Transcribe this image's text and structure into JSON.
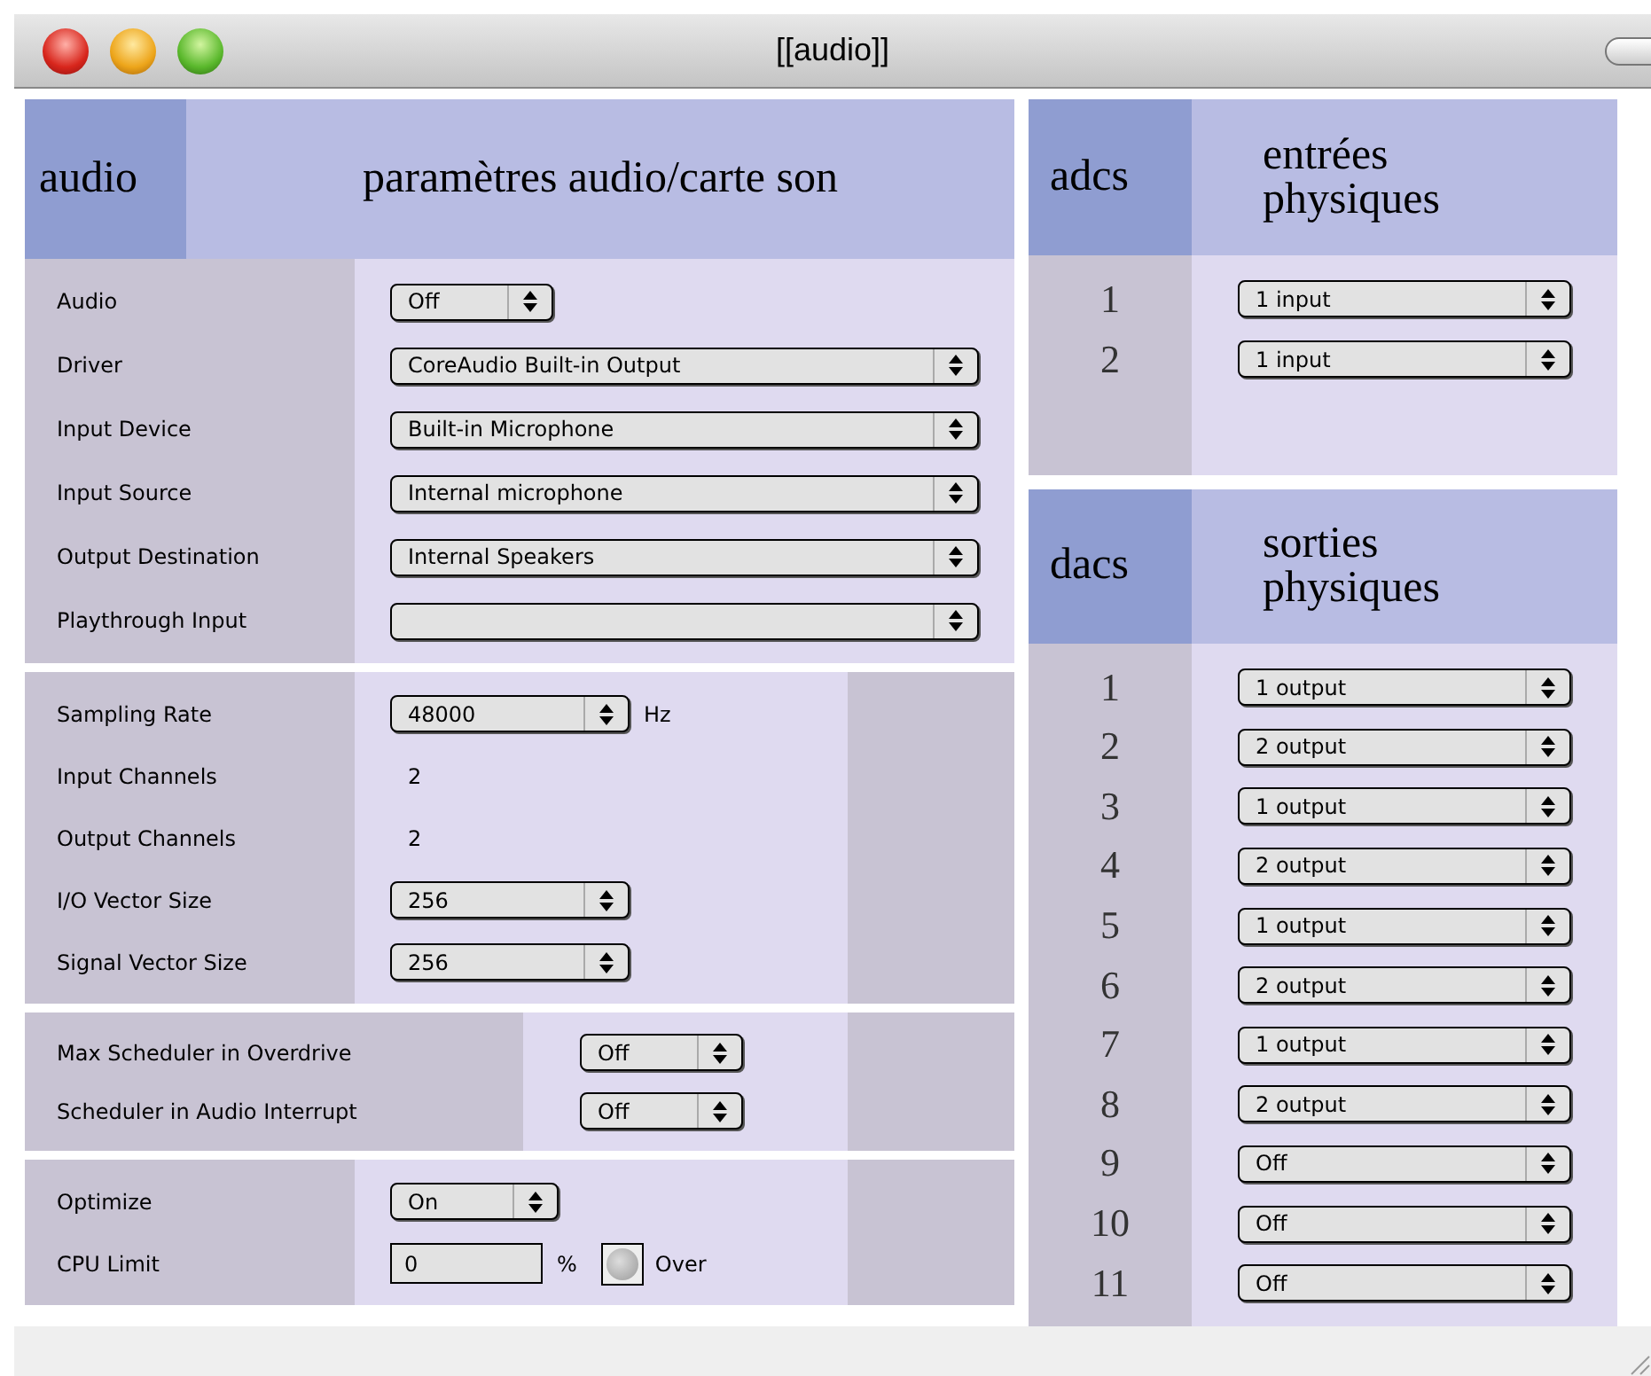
{
  "window": {
    "title": "[[audio]]"
  },
  "audio_panel": {
    "tag": "audio",
    "heading": "paramètres audio/carte son",
    "device_settings": [
      {
        "label": "Audio",
        "value": "Off"
      },
      {
        "label": "Driver",
        "value": "CoreAudio Built-in Output"
      },
      {
        "label": "Input Device",
        "value": "Built-in Microphone"
      },
      {
        "label": "Input Source",
        "value": "Internal microphone"
      },
      {
        "label": "Output Destination",
        "value": "Internal Speakers"
      },
      {
        "label": "Playthrough Input"
      }
    ],
    "signal_settings": [
      {
        "kind": "select",
        "label": "Sampling Rate",
        "value": "48000",
        "unit": "Hz"
      },
      {
        "kind": "readout",
        "label": "Input Channels",
        "value": "2"
      },
      {
        "kind": "readout",
        "label": "Output Channels",
        "value": "2"
      },
      {
        "kind": "select",
        "label": "I/O Vector Size",
        "value": "256"
      },
      {
        "kind": "select",
        "label": "Signal Vector Size",
        "value": "256"
      }
    ],
    "scheduler_settings": [
      {
        "label": "Max Scheduler in Overdrive",
        "value": "Off"
      },
      {
        "label": "Scheduler in Audio Interrupt",
        "value": "Off"
      }
    ],
    "performance_settings": [
      {
        "kind": "select",
        "label": "Optimize",
        "value": "On"
      },
      {
        "kind": "number",
        "label": "CPU Limit",
        "value": "0",
        "unit": "%",
        "indicator": {
          "label": "Over",
          "lit": false
        }
      }
    ]
  },
  "adcs_panel": {
    "tag": "adcs",
    "heading": "entrées physiques",
    "rows": [
      {
        "number": "1",
        "value": "1 input"
      },
      {
        "number": "2",
        "value": "1 input"
      }
    ]
  },
  "dacs_panel": {
    "tag": "dacs",
    "heading": "sorties physiques",
    "rows": [
      {
        "number": "1",
        "value": "1 output"
      },
      {
        "number": "2",
        "value": "2 output"
      },
      {
        "number": "3",
        "value": "1 output"
      },
      {
        "number": "4",
        "value": "2 output"
      },
      {
        "number": "5",
        "value": "1 output"
      },
      {
        "number": "6",
        "value": "2 output"
      },
      {
        "number": "7",
        "value": "1 output"
      },
      {
        "number": "8",
        "value": "2 output"
      },
      {
        "number": "9",
        "value": "Off"
      },
      {
        "number": "10",
        "value": "Off"
      },
      {
        "number": "11",
        "value": "Off"
      }
    ]
  }
}
